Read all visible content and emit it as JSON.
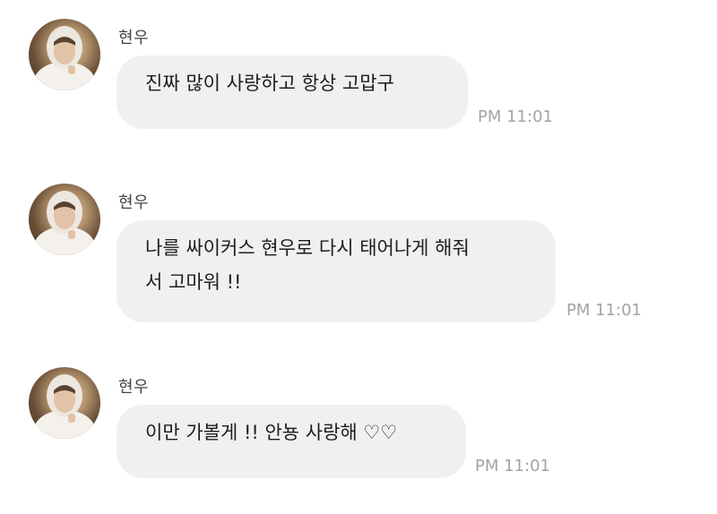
{
  "messages": [
    {
      "sender": "현우",
      "text": "진짜 많이 사랑하고 항상 고맙구",
      "time": "PM 11:01"
    },
    {
      "sender": "현우",
      "text": "나를 싸이커스 현우로 다시 태어나게 해줘\n서 고마워 !!",
      "time": "PM 11:01"
    },
    {
      "sender": "현우",
      "text": "이만 가볼게 !! 안뇽 사랑해 ♡♡",
      "time": "PM 11:01"
    }
  ],
  "colors": {
    "background": "#ffffff",
    "bubble": "#f0f0f2",
    "timestamp": "#a3a3a3",
    "sender": "#444444"
  }
}
